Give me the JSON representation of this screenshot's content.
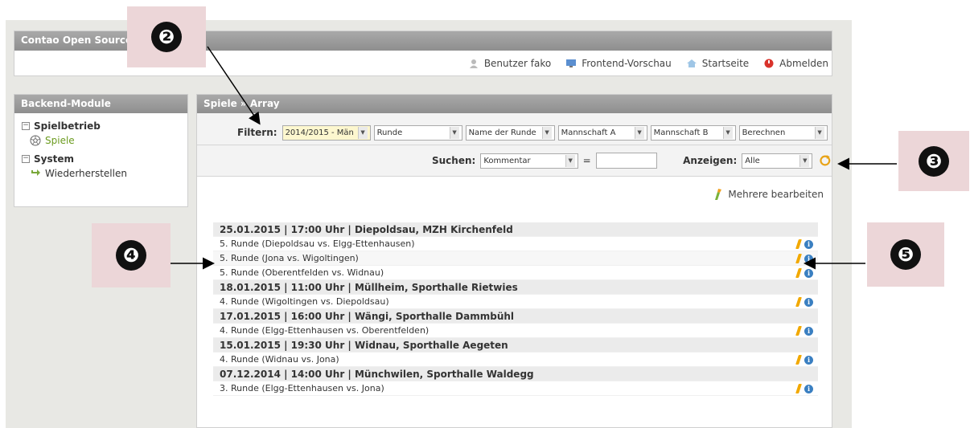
{
  "header": {
    "title": "Contao Open Source",
    "nav": [
      {
        "icon": "user-icon",
        "label": "Benutzer fako"
      },
      {
        "icon": "monitor-icon",
        "label": "Frontend-Vorschau"
      },
      {
        "icon": "home-icon",
        "label": "Startseite"
      },
      {
        "icon": "power-icon",
        "label": "Abmelden"
      }
    ]
  },
  "sidebar": {
    "title": "Backend-Module",
    "groups": [
      {
        "toggle": "−",
        "label": "Spielbetrieb",
        "items": [
          {
            "icon": "ball-icon",
            "label": "Spiele"
          }
        ]
      },
      {
        "toggle": "−",
        "label": "System",
        "items": [
          {
            "icon": "restore-arrow-icon",
            "label": "Wiederherstellen"
          }
        ]
      }
    ]
  },
  "main": {
    "breadcrumb": "Spiele » Array",
    "filter_label": "Filtern:",
    "filters": [
      "2014/2015 - Män",
      "Runde",
      "Name der Runde",
      "Mannschaft A",
      "Mannschaft B",
      "Berechnen"
    ],
    "search_label": "Suchen:",
    "search_field": "Kommentar",
    "equals": "=",
    "search_value": "",
    "show_label": "Anzeigen:",
    "show_value": "Alle",
    "edit_multiple": "Mehrere bearbeiten",
    "rows": [
      {
        "type": "head",
        "text": "25.01.2015 | 17:00 Uhr | Diepoldsau, MZH Kirchenfeld"
      },
      {
        "type": "item",
        "text": "5. Runde (Diepoldsau vs. Elgg-Ettenhausen)"
      },
      {
        "type": "item",
        "text": "5. Runde (Jona vs. Wigoltingen)"
      },
      {
        "type": "item",
        "text": "5. Runde (Oberentfelden vs. Widnau)"
      },
      {
        "type": "head",
        "text": "18.01.2015 | 11:00 Uhr | Müllheim, Sporthalle Rietwies"
      },
      {
        "type": "item",
        "text": "4. Runde (Wigoltingen vs. Diepoldsau)"
      },
      {
        "type": "head",
        "text": "17.01.2015 | 16:00 Uhr | Wängi, Sporthalle Dammbühl"
      },
      {
        "type": "item",
        "text": "4. Runde (Elgg-Ettenhausen vs. Oberentfelden)"
      },
      {
        "type": "head",
        "text": "15.01.2015 | 19:30 Uhr | Widnau, Sporthalle Aegeten"
      },
      {
        "type": "item",
        "text": "4. Runde (Widnau vs. Jona)"
      },
      {
        "type": "head",
        "text": "07.12.2014 | 14:00 Uhr | Münchwilen, Sporthalle Waldegg"
      },
      {
        "type": "item",
        "text": "3. Runde (Elgg-Ettenhausen vs. Jona)"
      }
    ],
    "op_icons": [
      "pencil-icon",
      "info-icon"
    ]
  },
  "callouts": [
    "❷",
    "❸",
    "❹",
    "❺"
  ],
  "colors": {
    "header_bar": "#9a9a9a",
    "active_module": "#6b9b1f",
    "filter_highlight": "#fdf7cf",
    "callout_bg": "#ecd6d8",
    "info_icon": "#3a7fc1",
    "pencil_icon": "#f2a900"
  }
}
